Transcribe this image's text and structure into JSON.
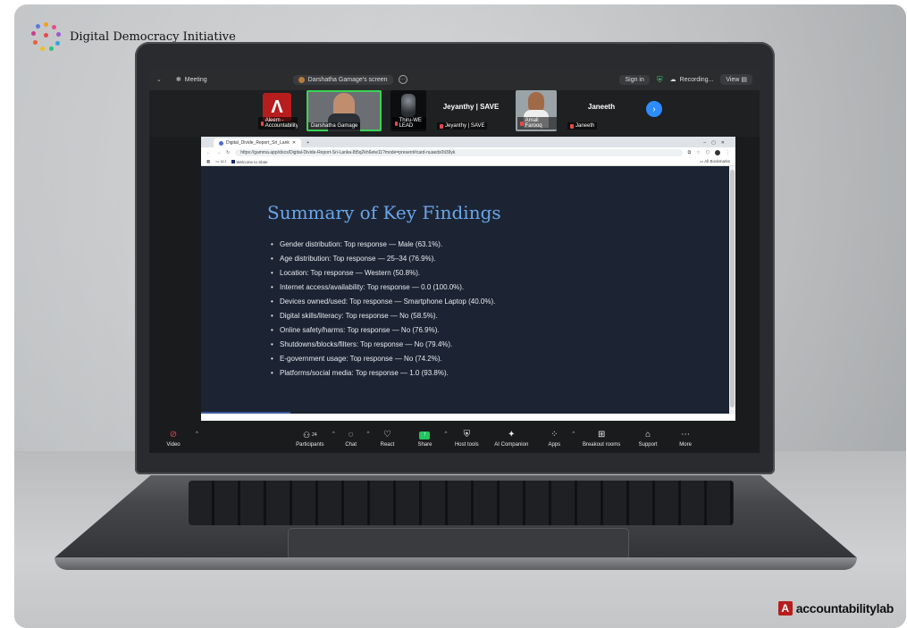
{
  "brand": {
    "title": "Digital Democracy Initiative"
  },
  "footer_logo": {
    "mark": "A",
    "text": "accountabilitylab"
  },
  "zoom": {
    "meeting_label": "Meeting",
    "screen_title": "Darshatha Gamage's screen",
    "sign_in": "Sign in",
    "recording": "Recording...",
    "view": "View",
    "participants": [
      {
        "name": "Aleem - Accountability...",
        "big": ""
      },
      {
        "name": "Darshatha Gamage",
        "big": ""
      },
      {
        "name": "Thiru-WE LEAD",
        "big": ""
      },
      {
        "name": "Jeyanthy | SAVE",
        "big": "Jeyanthy | SAVE"
      },
      {
        "name": "Amali Farooq",
        "big": ""
      },
      {
        "name": "Janeeth",
        "big": "Janeeth"
      }
    ],
    "toolbar": {
      "video": "Video",
      "participants": "Participants",
      "participants_count": "24",
      "chat": "Chat",
      "react": "React",
      "share": "Share",
      "host_tools": "Host tools",
      "ai_companion": "AI Companion",
      "apps": "Apps",
      "breakout_rooms": "Breakout rooms",
      "support": "Support",
      "more": "More"
    }
  },
  "browser": {
    "tab_title": "Digital_Divide_Report_Sri_Lank",
    "url": "https://gamma.app/docs/Digital-Divide-Report-Sri-Lanka-8t5q2kh6eiw11?mode=present#card-nuaedx0ti39yk",
    "bookmark_1": "LLI",
    "bookmark_2": "Welcome to Slate",
    "all_bookmarks": "All Bookmarks"
  },
  "slide": {
    "title": "Summary of Key Findings",
    "findings": [
      "Gender distribution: Top response — Male (63.1%).",
      "Age distribution: Top response — 25–34 (76.9%).",
      "Location: Top response — Western (50.8%).",
      "Internet access/availability: Top response — 0.0 (100.0%).",
      "Devices owned/used: Top response — Smartphone Laptop (40.0%).",
      "Digital skills/literacy: Top response — No (58.5%).",
      "Online safety/harms: Top response — No (76.9%).",
      "Shutdowns/blocks/filters: Top response — No (79.4%).",
      "E-government usage: Top response — No (74.2%).",
      "Platforms/social media: Top response — 1.0 (93.8%)."
    ]
  },
  "colors": {
    "slide_bg": "#1c2433",
    "slide_title": "#6aa6e8",
    "share_green": "#22c55e",
    "brand_red": "#b71d1d"
  }
}
